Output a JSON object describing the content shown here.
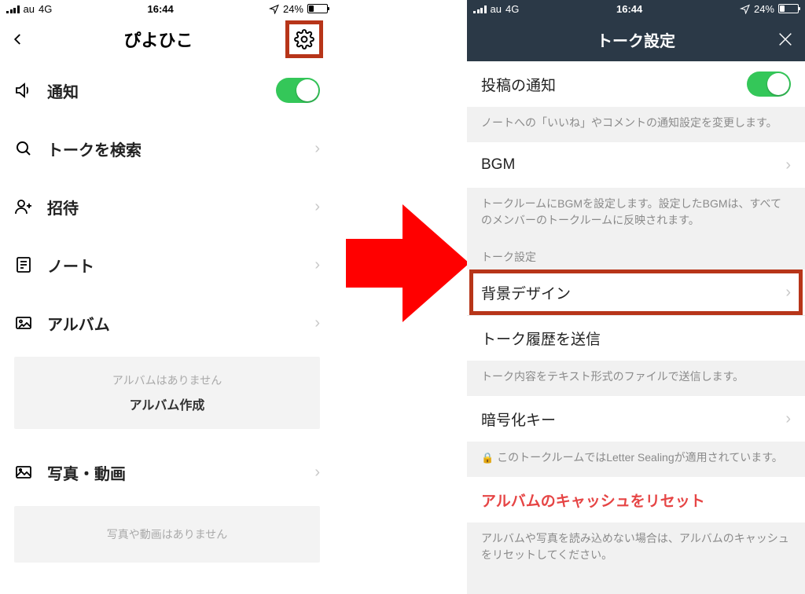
{
  "status": {
    "carrier": "au",
    "network": "4G",
    "time": "16:44",
    "battery_pct": "24%"
  },
  "left": {
    "title": "ぴよひこ",
    "rows": {
      "notify": "通知",
      "search": "トークを検索",
      "invite": "招待",
      "note": "ノート",
      "album": "アルバム",
      "photos": "写真・動画"
    },
    "album_card": {
      "empty": "アルバムはありません",
      "create": "アルバム作成"
    },
    "photos_card": {
      "empty": "写真や動画はありません"
    }
  },
  "right": {
    "title": "トーク設定",
    "post_notify": "投稿の通知",
    "post_notify_desc": "ノートへの「いいね」やコメントの通知設定を変更します。",
    "bgm": "BGM",
    "bgm_desc": "トークルームにBGMを設定します。設定したBGMは、すべてのメンバーのトークルームに反映されます。",
    "section_talk": "トーク設定",
    "bg": "背景デザイン",
    "send_history": "トーク履歴を送信",
    "send_history_desc": "トーク内容をテキスト形式のファイルで送信します。",
    "enc_key": "暗号化キー",
    "enc_desc": "このトークルームではLetter Sealingが適用されています。",
    "album_reset": "アルバムのキャッシュをリセット",
    "album_reset_desc": "アルバムや写真を読み込めない場合は、アルバムのキャッシュをリセットしてください。"
  }
}
